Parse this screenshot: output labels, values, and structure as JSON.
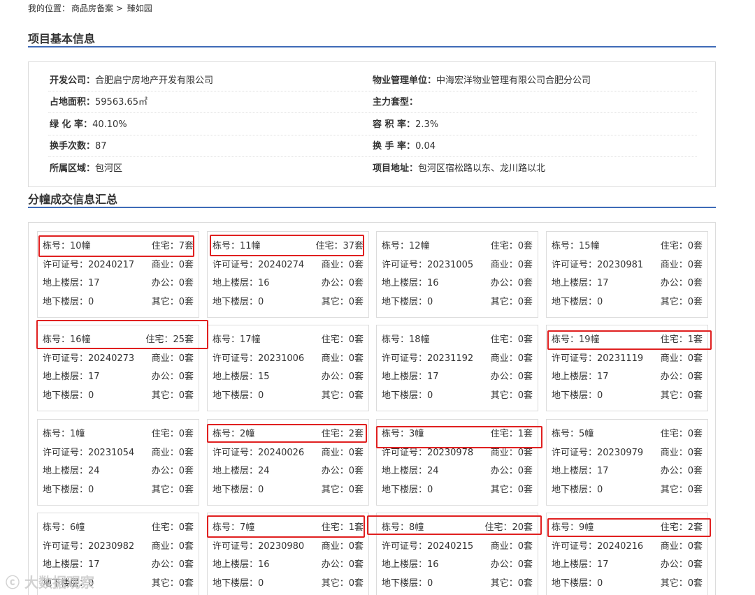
{
  "breadcrumb": {
    "prefix": "我的位置：",
    "items": [
      "商品房备案",
      "臻如园"
    ],
    "sep": ">"
  },
  "section1": {
    "title": "项目基本信息"
  },
  "info": {
    "rows": [
      {
        "lk": "开发公司：",
        "lv": "合肥启宁房地产开发有限公司",
        "rk": "物业管理单位：",
        "rv": "中海宏洋物业管理有限公司合肥分公司"
      },
      {
        "lk": "占地面积：",
        "lv": "59563.65㎡",
        "rk": "主力套型：",
        "rv": ""
      },
      {
        "lk": "绿 化 率：",
        "lv": "40.10%",
        "rk": "容 积 率：",
        "rv": "2.3%"
      },
      {
        "lk": "换手次数：",
        "lv": "87",
        "rk": "换 手 率：",
        "rv": "0.04"
      },
      {
        "lk": "所属区域：",
        "lv": "包河区",
        "rk": "项目地址：",
        "rv": "包河区宿松路以东、龙川路以北"
      }
    ]
  },
  "section2": {
    "title": "分幢成交信息汇总"
  },
  "buildings": [
    {
      "num": "栋号：10幢",
      "res": "住宅：7套",
      "permit": "许可证号：20240217",
      "com": "商业：0套",
      "above": "地上楼层：17",
      "off": "办公：0套",
      "below": "地下楼层：0",
      "oth": "其它：0套"
    },
    {
      "num": "栋号：11幢",
      "res": "住宅：37套",
      "permit": "许可证号：20240274",
      "com": "商业：0套",
      "above": "地上楼层：16",
      "off": "办公：0套",
      "below": "地下楼层：0",
      "oth": "其它：0套"
    },
    {
      "num": "栋号：12幢",
      "res": "住宅：0套",
      "permit": "许可证号：20231005",
      "com": "商业：0套",
      "above": "地上楼层：16",
      "off": "办公：0套",
      "below": "地下楼层：0",
      "oth": "其它：0套"
    },
    {
      "num": "栋号：15幢",
      "res": "住宅：0套",
      "permit": "许可证号：20230981",
      "com": "商业：0套",
      "above": "地上楼层：17",
      "off": "办公：0套",
      "below": "地下楼层：0",
      "oth": "其它：0套"
    },
    {
      "num": "栋号：16幢",
      "res": "住宅：25套",
      "permit": "许可证号：20240273",
      "com": "商业：0套",
      "above": "地上楼层：17",
      "off": "办公：0套",
      "below": "地下楼层：0",
      "oth": "其它：0套"
    },
    {
      "num": "栋号：17幢",
      "res": "住宅：0套",
      "permit": "许可证号：20231006",
      "com": "商业：0套",
      "above": "地上楼层：15",
      "off": "办公：0套",
      "below": "地下楼层：0",
      "oth": "其它：0套"
    },
    {
      "num": "栋号：18幢",
      "res": "住宅：0套",
      "permit": "许可证号：20231192",
      "com": "商业：0套",
      "above": "地上楼层：17",
      "off": "办公：0套",
      "below": "地下楼层：0",
      "oth": "其它：0套"
    },
    {
      "num": "栋号：19幢",
      "res": "住宅：1套",
      "permit": "许可证号：20231119",
      "com": "商业：0套",
      "above": "地上楼层：17",
      "off": "办公：0套",
      "below": "地下楼层：0",
      "oth": "其它：0套"
    },
    {
      "num": "栋号：1幢",
      "res": "住宅：0套",
      "permit": "许可证号：20231054",
      "com": "商业：0套",
      "above": "地上楼层：24",
      "off": "办公：0套",
      "below": "地下楼层：0",
      "oth": "其它：0套"
    },
    {
      "num": "栋号：2幢",
      "res": "住宅：2套",
      "permit": "许可证号：20240026",
      "com": "商业：0套",
      "above": "地上楼层：24",
      "off": "办公：0套",
      "below": "地下楼层：0",
      "oth": "其它：0套"
    },
    {
      "num": "栋号：3幢",
      "res": "住宅：1套",
      "permit": "许可证号：20230978",
      "com": "商业：0套",
      "above": "地上楼层：24",
      "off": "办公：0套",
      "below": "地下楼层：0",
      "oth": "其它：0套"
    },
    {
      "num": "栋号：5幢",
      "res": "住宅：0套",
      "permit": "许可证号：20230979",
      "com": "商业：0套",
      "above": "地上楼层：17",
      "off": "办公：0套",
      "below": "地下楼层：0",
      "oth": "其它：0套"
    },
    {
      "num": "栋号：6幢",
      "res": "住宅：0套",
      "permit": "许可证号：20230982",
      "com": "商业：0套",
      "above": "地上楼层：17",
      "off": "办公：0套",
      "below": "地下楼层：0",
      "oth": "其它：0套"
    },
    {
      "num": "栋号：7幢",
      "res": "住宅：1套",
      "permit": "许可证号：20230980",
      "com": "商业：0套",
      "above": "地上楼层：16",
      "off": "办公：0套",
      "below": "地下楼层：0",
      "oth": "其它：0套"
    },
    {
      "num": "栋号：8幢",
      "res": "住宅：20套",
      "permit": "许可证号：20240215",
      "com": "商业：0套",
      "above": "地上楼层：16",
      "off": "办公：0套",
      "below": "地下楼层：0",
      "oth": "其它：0套"
    },
    {
      "num": "栋号：9幢",
      "res": "住宅：2套",
      "permit": "许可证号：20240216",
      "com": "商业：0套",
      "above": "地上楼层：17",
      "off": "办公：0套",
      "below": "地下楼层：0",
      "oth": "其它：0套"
    }
  ],
  "watermark": {
    "text": "大数据观察"
  },
  "colors": {
    "accent_line": "#3e6bb7",
    "highlight": "#e02020",
    "border": "#dcdcdc"
  }
}
